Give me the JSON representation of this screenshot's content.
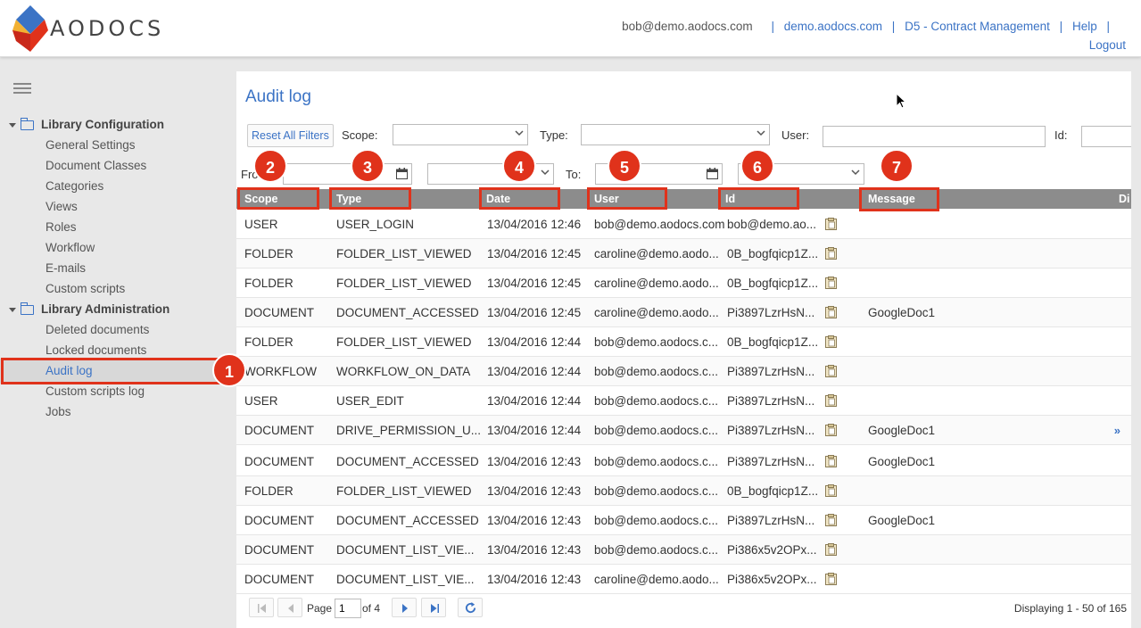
{
  "app": {
    "logo_text": "AODOCS"
  },
  "topnav": {
    "email": "bob@demo.aodocs.com",
    "domain": "demo.aodocs.com",
    "library": "D5 - Contract Management",
    "help": "Help",
    "logout": "Logout",
    "separator": "|"
  },
  "sidebar": {
    "sections": [
      {
        "label": "Library Configuration",
        "items": [
          "General Settings",
          "Document Classes",
          "Categories",
          "Views",
          "Roles",
          "Workflow",
          "E-mails",
          "Custom scripts"
        ]
      },
      {
        "label": "Library Administration",
        "items": [
          "Deleted documents",
          "Locked documents",
          "Audit log",
          "Custom scripts log",
          "Jobs"
        ]
      }
    ],
    "active_item": "Audit log"
  },
  "main": {
    "title": "Audit log",
    "reset_label": "Reset All Filters",
    "filters": {
      "scope_label": "Scope:",
      "type_label": "Type:",
      "user_label": "User:",
      "id_label": "Id:",
      "from_label": "From:",
      "to_label": "To:"
    },
    "columns": [
      "Scope",
      "Type",
      "Date",
      "User",
      "Id",
      "Message",
      "Di"
    ],
    "rows": [
      {
        "scope": "USER",
        "type": "USER_LOGIN",
        "date": "13/04/2016 12:46",
        "user": "bob@demo.aodocs.com",
        "id": "bob@demo.ao...",
        "message": ""
      },
      {
        "scope": "FOLDER",
        "type": "FOLDER_LIST_VIEWED",
        "date": "13/04/2016 12:45",
        "user": "caroline@demo.aodo...",
        "id": "0B_bogfqicp1Z...",
        "message": ""
      },
      {
        "scope": "FOLDER",
        "type": "FOLDER_LIST_VIEWED",
        "date": "13/04/2016 12:45",
        "user": "caroline@demo.aodo...",
        "id": "0B_bogfqicp1Z...",
        "message": ""
      },
      {
        "scope": "DOCUMENT",
        "type": "DOCUMENT_ACCESSED",
        "date": "13/04/2016 12:45",
        "user": "caroline@demo.aodo...",
        "id": "Pi3897LzrHsN...",
        "message": "GoogleDoc1"
      },
      {
        "scope": "FOLDER",
        "type": "FOLDER_LIST_VIEWED",
        "date": "13/04/2016 12:44",
        "user": "bob@demo.aodocs.c...",
        "id": "0B_bogfqicp1Z...",
        "message": ""
      },
      {
        "scope": "WORKFLOW",
        "type": "WORKFLOW_ON_DATA",
        "date": "13/04/2016 12:44",
        "user": "bob@demo.aodocs.c...",
        "id": "Pi3897LzrHsN...",
        "message": ""
      },
      {
        "scope": "USER",
        "type": "USER_EDIT",
        "date": "13/04/2016 12:44",
        "user": "bob@demo.aodocs.c...",
        "id": "Pi3897LzrHsN...",
        "message": ""
      },
      {
        "scope": "DOCUMENT",
        "type": "DRIVE_PERMISSION_U...",
        "date": "13/04/2016 12:44",
        "user": "bob@demo.aodocs.c...",
        "id": "Pi3897LzrHsN...",
        "message": "GoogleDoc1"
      },
      {
        "scope": "DOCUMENT",
        "type": "DOCUMENT_ACCESSED",
        "date": "13/04/2016 12:43",
        "user": "bob@demo.aodocs.c...",
        "id": "Pi3897LzrHsN...",
        "message": "GoogleDoc1"
      },
      {
        "scope": "FOLDER",
        "type": "FOLDER_LIST_VIEWED",
        "date": "13/04/2016 12:43",
        "user": "bob@demo.aodocs.c...",
        "id": "0B_bogfqicp1Z...",
        "message": ""
      },
      {
        "scope": "DOCUMENT",
        "type": "DOCUMENT_ACCESSED",
        "date": "13/04/2016 12:43",
        "user": "bob@demo.aodocs.c...",
        "id": "Pi3897LzrHsN...",
        "message": "GoogleDoc1"
      },
      {
        "scope": "DOCUMENT",
        "type": "DOCUMENT_LIST_VIE...",
        "date": "13/04/2016 12:43",
        "user": "bob@demo.aodocs.c...",
        "id": "Pi386x5v2OPx...",
        "message": ""
      },
      {
        "scope": "DOCUMENT",
        "type": "DOCUMENT_LIST_VIE...",
        "date": "13/04/2016 12:43",
        "user": "caroline@demo.aodo...",
        "id": "Pi386x5v2OPx...",
        "message": ""
      }
    ],
    "expand_glyph": "»"
  },
  "pager": {
    "page_label": "Page",
    "page_value": "1",
    "of_label": "of 4",
    "display": "Displaying 1 - 50 of 165"
  },
  "annotations": [
    "1",
    "2",
    "3",
    "4",
    "5",
    "6",
    "7"
  ],
  "colors": {
    "accent": "#3b73c5",
    "annotation": "#e0321b",
    "header_row": "#8c8c8c"
  }
}
